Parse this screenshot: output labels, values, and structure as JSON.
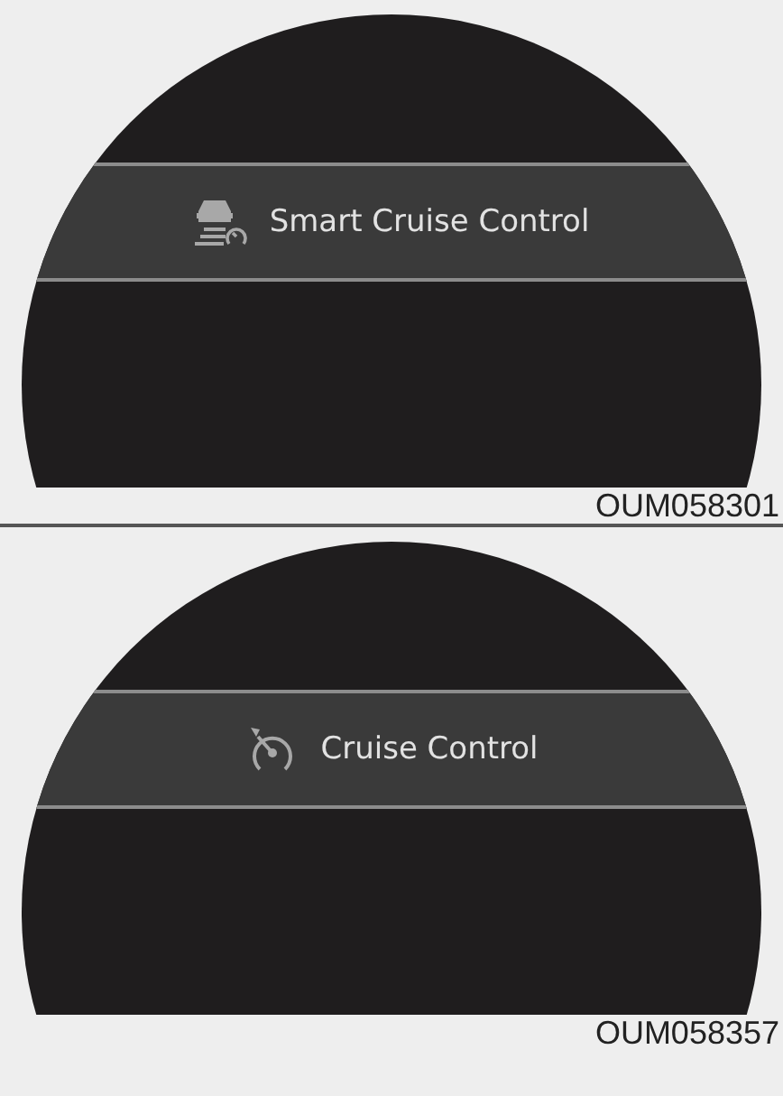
{
  "panels": [
    {
      "menu_item": {
        "kind": "smart-cruise",
        "label": "Smart Cruise Control"
      },
      "caption": "OUM058301"
    },
    {
      "menu_item": {
        "kind": "cruise",
        "label": "Cruise Control"
      },
      "caption": "OUM058357"
    }
  ]
}
